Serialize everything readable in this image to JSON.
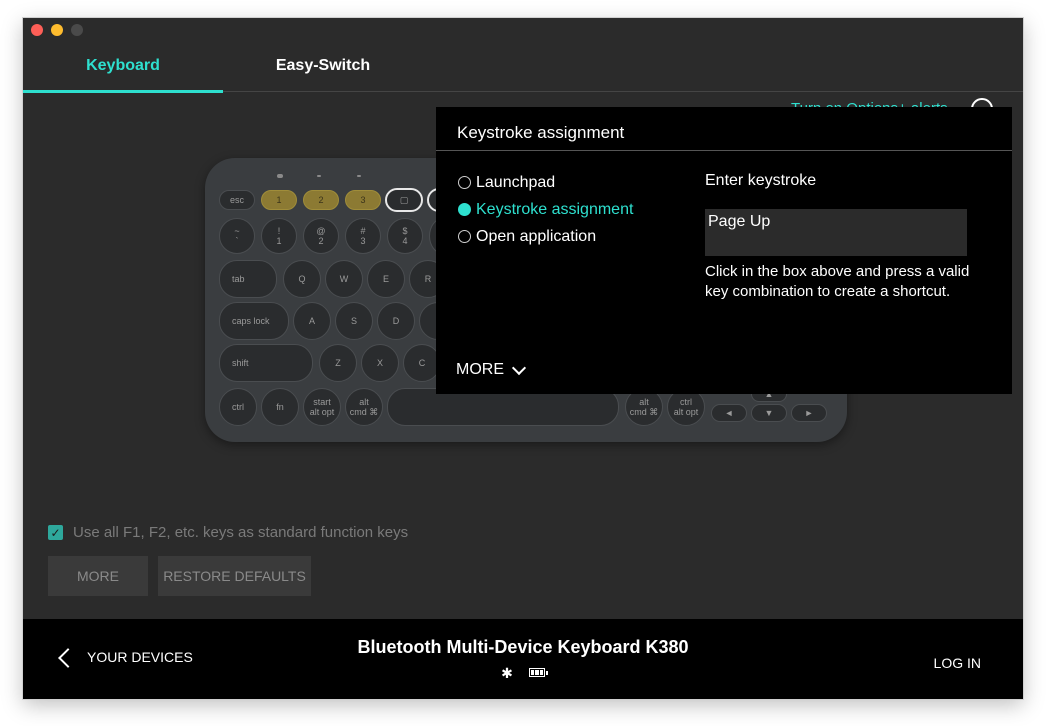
{
  "tabs": [
    {
      "label": "Keyboard",
      "active": true
    },
    {
      "label": "Easy-Switch",
      "active": false
    }
  ],
  "top_link": "Turn on Options+ alerts",
  "keyboard": {
    "fkeys": [
      {
        "label": "esc"
      },
      {
        "label": "1"
      },
      {
        "label": "2"
      },
      {
        "label": "3"
      }
    ],
    "number_row": [
      "~",
      "!",
      "@",
      "#",
      "$"
    ],
    "number_row_sub": [
      "`",
      "1",
      "2",
      "3",
      "4"
    ],
    "row_q": [
      "tab",
      "Q",
      "W",
      "E",
      "R"
    ],
    "row_a": [
      "caps lock",
      "A",
      "S",
      "D"
    ],
    "row_z": [
      "shift",
      "Z",
      "X",
      "C"
    ],
    "row_bottom": [
      "ctrl",
      "fn",
      "start",
      "alt",
      "alt",
      "ctrl"
    ],
    "row_bottom_sub": [
      "alt opt",
      "cmd ⌘",
      "cmd ⌘",
      "alt opt"
    ],
    "arrows": [
      "◄",
      "▼",
      "►",
      "▲"
    ]
  },
  "options": {
    "checkbox_checked": true,
    "function_keys_label": "Use all F1, F2, etc. keys as standard function keys",
    "more_label": "MORE",
    "restore_label": "RESTORE DEFAULTS"
  },
  "footer": {
    "back_label": "YOUR DEVICES",
    "device_name": "Bluetooth Multi-Device Keyboard K380",
    "bluetooth_glyph": "✱",
    "login_label": "LOG IN"
  },
  "popup": {
    "title": "Keystroke assignment",
    "options": [
      {
        "label": "Launchpad",
        "selected": false
      },
      {
        "label": "Keystroke assignment",
        "selected": true
      },
      {
        "label": "Open application",
        "selected": false
      }
    ],
    "more_label": "MORE",
    "enter_label": "Enter keystroke",
    "keystroke_value": "Page Up",
    "help_text": "Click in the box above and press a valid key combination to create a shortcut."
  },
  "colors": {
    "accent": "#2ee0cf",
    "background": "#2b2b2b",
    "footer": "#000000",
    "gold_key": "#8c7a33"
  }
}
